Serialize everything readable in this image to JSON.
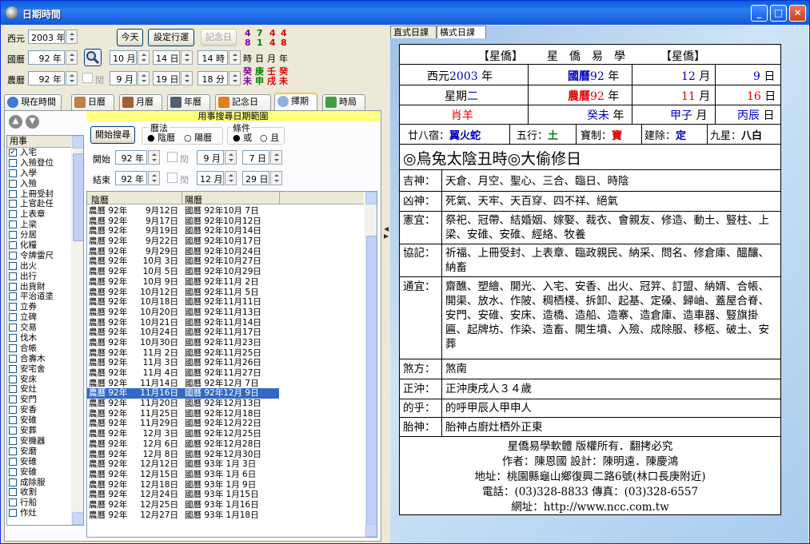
{
  "window": {
    "title": "日期時間"
  },
  "top": {
    "xiyuan_label": "西元",
    "xiyuan_value": "2003 年",
    "guoli_label": "國曆",
    "guoli_value": "92 年",
    "nongli_label": "農曆",
    "nongli_value": "92 年",
    "run_label": "閏",
    "today_btn": "今天",
    "set_btn": "設定行運",
    "memo_btn": "記念日",
    "g_month": "10 月",
    "g_day": "14 日",
    "g_hour": "14 時",
    "n_month": "9 月",
    "n_day": "19 日",
    "n_min": "18 分",
    "pillar_top": [
      "4",
      "7",
      "4",
      "4"
    ],
    "pillar_mid": [
      "8",
      "1",
      "4",
      "8"
    ],
    "pillar_labels": [
      "時",
      "日",
      "月",
      "年"
    ],
    "pillar_stems": [
      "癸",
      "庚",
      "壬",
      "癸"
    ],
    "pillar_branches": [
      "未",
      "申",
      "戌",
      "未"
    ]
  },
  "tabs": [
    "現在時間",
    "日曆",
    "月曆",
    "年曆",
    "記念日",
    "擇期",
    "時局"
  ],
  "search": {
    "header": "用事搜尋日期範圍",
    "start_btn": "開始搜尋",
    "calendar_label": "曆法",
    "cal_yin": "陰曆",
    "cal_yang": "陽曆",
    "cond_label": "條件",
    "cond_or": "或",
    "cond_and": "且",
    "start_label": "開始",
    "end_label": "結束",
    "start_year": "92 年",
    "start_month": "9 月",
    "start_day": "7 日",
    "end_year": "92 年",
    "end_month": "12 月",
    "end_day": "29 日",
    "run_label": "閏",
    "col_yin": "陰曆",
    "col_yang": "陽曆"
  },
  "yongshi": {
    "header": "用事",
    "items": [
      "入宅",
      "入殮登位",
      "入學",
      "入殮",
      "上冊受封",
      "上官赴任",
      "上表章",
      "上梁",
      "分居",
      "化糧",
      "令牌雷尺",
      "出火",
      "出行",
      "出貨財",
      "平治道塗",
      "立券",
      "立碑",
      "交易",
      "伐木",
      "合帳",
      "合壽木",
      "安宅舍",
      "安床",
      "安灶",
      "安門",
      "安香",
      "安碓",
      "安葬",
      "安機器",
      "安磨",
      "安碓",
      "安碓",
      "成除服",
      "收割",
      "行船",
      "作灶"
    ]
  },
  "results": [
    [
      "農曆 92年",
      "9月12日",
      "國曆 92年10月 7日"
    ],
    [
      "農曆 92年",
      "9月17日",
      "國曆 92年10月12日"
    ],
    [
      "農曆 92年",
      "9月19日",
      "國曆 92年10月14日"
    ],
    [
      "農曆 92年",
      "9月22日",
      "國曆 92年10月17日"
    ],
    [
      "農曆 92年",
      "9月29日",
      "國曆 92年10月24日"
    ],
    [
      "農曆 92年",
      "10月 3日",
      "國曆 92年10月27日"
    ],
    [
      "農曆 92年",
      "10月 5日",
      "國曆 92年10月29日"
    ],
    [
      "農曆 92年",
      "10月 9日",
      "國曆 92年11月 2日"
    ],
    [
      "農曆 92年",
      "10月12日",
      "國曆 92年11月 5日"
    ],
    [
      "農曆 92年",
      "10月18日",
      "國曆 92年11月11日"
    ],
    [
      "農曆 92年",
      "10月20日",
      "國曆 92年11月13日"
    ],
    [
      "農曆 92年",
      "10月21日",
      "國曆 92年11月14日"
    ],
    [
      "農曆 92年",
      "10月24日",
      "國曆 92年11月17日"
    ],
    [
      "農曆 92年",
      "10月30日",
      "國曆 92年11月23日"
    ],
    [
      "農曆 92年",
      "11月 2日",
      "國曆 92年11月25日"
    ],
    [
      "農曆 92年",
      "11月 3日",
      "國曆 92年11月26日"
    ],
    [
      "農曆 92年",
      "11月 4日",
      "國曆 92年11月27日"
    ],
    [
      "農曆 92年",
      "11月14日",
      "國曆 92年12月 7日"
    ],
    [
      "農曆 92年",
      "11月16日",
      "國曆 92年12月 9日"
    ],
    [
      "農曆 92年",
      "11月20日",
      "國曆 92年12月13日"
    ],
    [
      "農曆 92年",
      "11月25日",
      "國曆 92年12月18日"
    ],
    [
      "農曆 92年",
      "11月29日",
      "國曆 92年12月22日"
    ],
    [
      "農曆 92年",
      "12月 3日",
      "國曆 92年12月25日"
    ],
    [
      "農曆 92年",
      "12月 6日",
      "國曆 92年12月28日"
    ],
    [
      "農曆 92年",
      "12月 8日",
      "國曆 92年12月30日"
    ],
    [
      "農曆 92年",
      "12月12日",
      "國曆 93年 1月 3日"
    ],
    [
      "農曆 92年",
      "12月15日",
      "國曆 93年 1月 6日"
    ],
    [
      "農曆 92年",
      "12月18日",
      "國曆 93年 1月 9日"
    ],
    [
      "農曆 92年",
      "12月24日",
      "國曆 93年 1月15日"
    ],
    [
      "農曆 92年",
      "12月25日",
      "國曆 93年 1月16日"
    ],
    [
      "農曆 92年",
      "12月27日",
      "國曆 93年 1月18日"
    ]
  ],
  "right_tabs": [
    "直式日課",
    "橫式日課"
  ],
  "card": {
    "h1": "【星僑】",
    "h2": "星　僑　易　學",
    "h3": "【星僑】",
    "r1a": "西元",
    "r1a_v": "2003",
    "r1a_u": "年",
    "r1b": "國曆",
    "r1b_v": "92",
    "r1b_u": "年",
    "r1c_v": "12",
    "r1c_u": "月",
    "r1d_v": "9",
    "r1d_u": "日",
    "r2a": "星期",
    "r2a_v": "二",
    "r2b": "農曆",
    "r2b_v": "92",
    "r2b_u": "年",
    "r2c_v": "11",
    "r2c_u": "月",
    "r2d_v": "16",
    "r2d_u": "日",
    "r3a": "肖羊",
    "r3b": "癸未",
    "r3b_u": "年",
    "r3c": "甲子",
    "r3c_u": "月",
    "r3d": "丙辰",
    "r3d_u": "日",
    "r4a": "廿八宿：",
    "r4a_v": "翼火蛇",
    "r4b": "五行：",
    "r4b_v": "土",
    "r4c": "寶制：",
    "r4c_v": "寶",
    "r4d": "建除：",
    "r4d_v": "定",
    "r4e": "九星：",
    "r4e_v": "八白",
    "big": "◎烏兔太陰丑時◎大偷修日",
    "k1": "吉神：",
    "v1": "天倉、月空、聖心、三合、臨日、時陰",
    "k2": "凶神：",
    "v2": "死氣、天牢、天百穿、四不祥、絕氣",
    "k3": "憲宜：",
    "v3": "祭祀、冠帶、結婚姻、嫁娶、裁衣、會親友、修造、動土、豎柱、上梁、安碓、安碓、經絡、牧養",
    "k4": "協記：",
    "v4": "祈福、上冊受封、上表章、臨政親民、納采、問名、修倉庫、醞釀、納畜",
    "k5": "通宜：",
    "v5": "齋醮、塑繪、開光、入宅、安香、出火、冠笄、訂盟、納婿、合帳、開渠、放水、作陂、稠栖棧、拆卸、起基、定磉、歸岫、蓋屋合脊、安門、安碓、安床、造橋、造船、造寨、造倉庫、造車器、豎旗掛匾、起牌坊、作染、造畜、開生墳、入殮、成除服、移柩、破土、安葬",
    "k6": "煞方：",
    "v6": "煞南",
    "k7": "正沖：",
    "v7": "正沖庚戌人３４歲",
    "k8": "的乎：",
    "v8": "的呼甲辰人甲申人",
    "k9": "胎神：",
    "v9": "胎神占廚灶栖外正東",
    "f1": "星僑易學軟體 版權所有．翻拷必究",
    "f2": "作者：陳恩國 設計：陳明遠．陳慶鴻",
    "f3": "地址：桃園縣龜山鄉復興二路6號(林口長庚附近)",
    "f4": "電話：(03)328-8833 傳真：(03)328-6557",
    "f5": "網址：http://www.ncc.com.tw"
  }
}
